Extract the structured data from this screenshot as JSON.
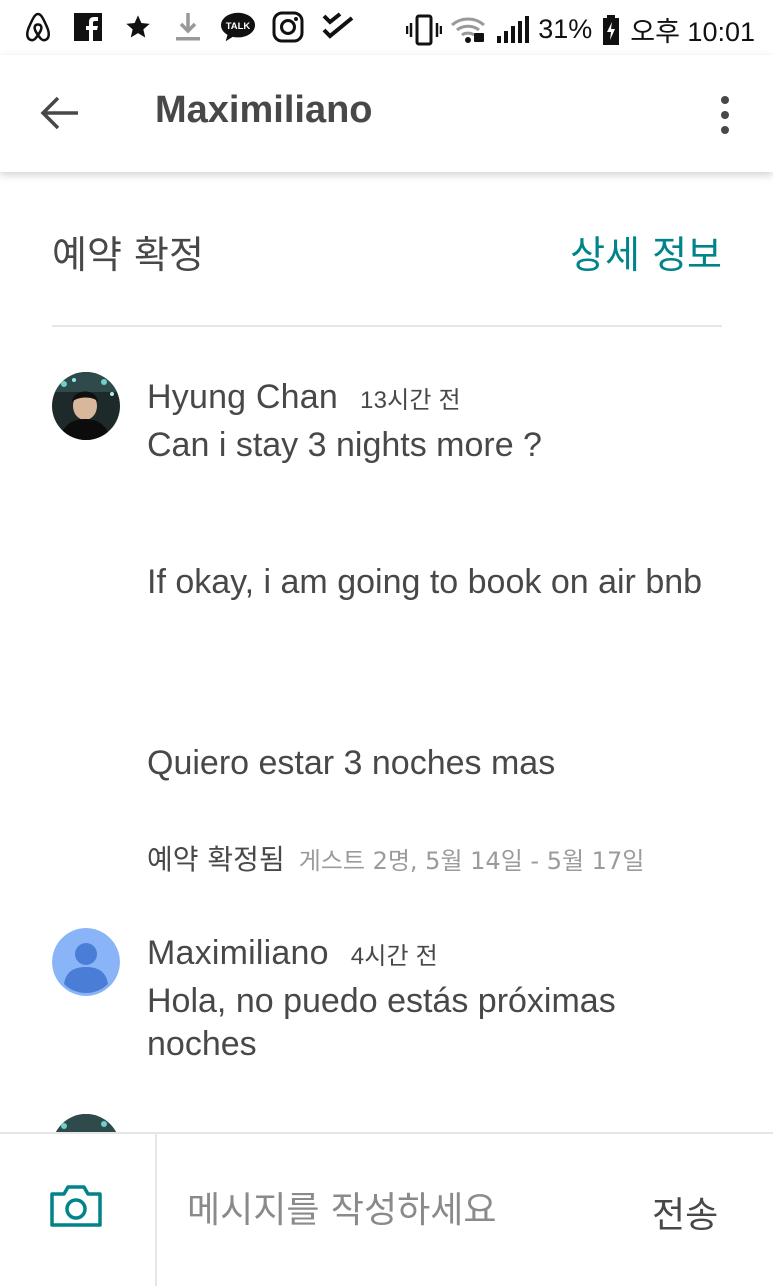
{
  "status_bar": {
    "left_icons": [
      "airbnb-icon",
      "facebook-icon",
      "star-icon",
      "download-icon",
      "kakaotalk-icon",
      "instagram-icon",
      "checklist-icon"
    ],
    "kakaotalk_label": "TALK",
    "battery": "31%",
    "time": "오후 10:01"
  },
  "header": {
    "title": "Maximiliano"
  },
  "reservation": {
    "status": "예약 확정",
    "details_link": "상세 정보"
  },
  "messages": [
    {
      "sender": "Hyung Chan",
      "time": "13시간 전",
      "avatar": "photo",
      "paragraphs": [
        "Can i stay 3 nights more ?",
        "If okay, i am going to book on air bnb",
        "Quiero estar 3 noches mas"
      ]
    },
    {
      "sender": "Maximiliano",
      "time": "4시간 전",
      "avatar": "default",
      "paragraphs": [
        "Hola, no puedo estás próximas noches"
      ]
    }
  ],
  "confirmation": {
    "label": "예약 확정됨",
    "detail": "게스트 2명,  5월 14일 - 5월 17일"
  },
  "composer": {
    "placeholder": "메시지를 작성하세요",
    "send_label": "전송"
  },
  "colors": {
    "accent": "#008489",
    "text": "#484848",
    "muted": "#9b9b9b",
    "default_avatar": "#8ab4f8"
  }
}
